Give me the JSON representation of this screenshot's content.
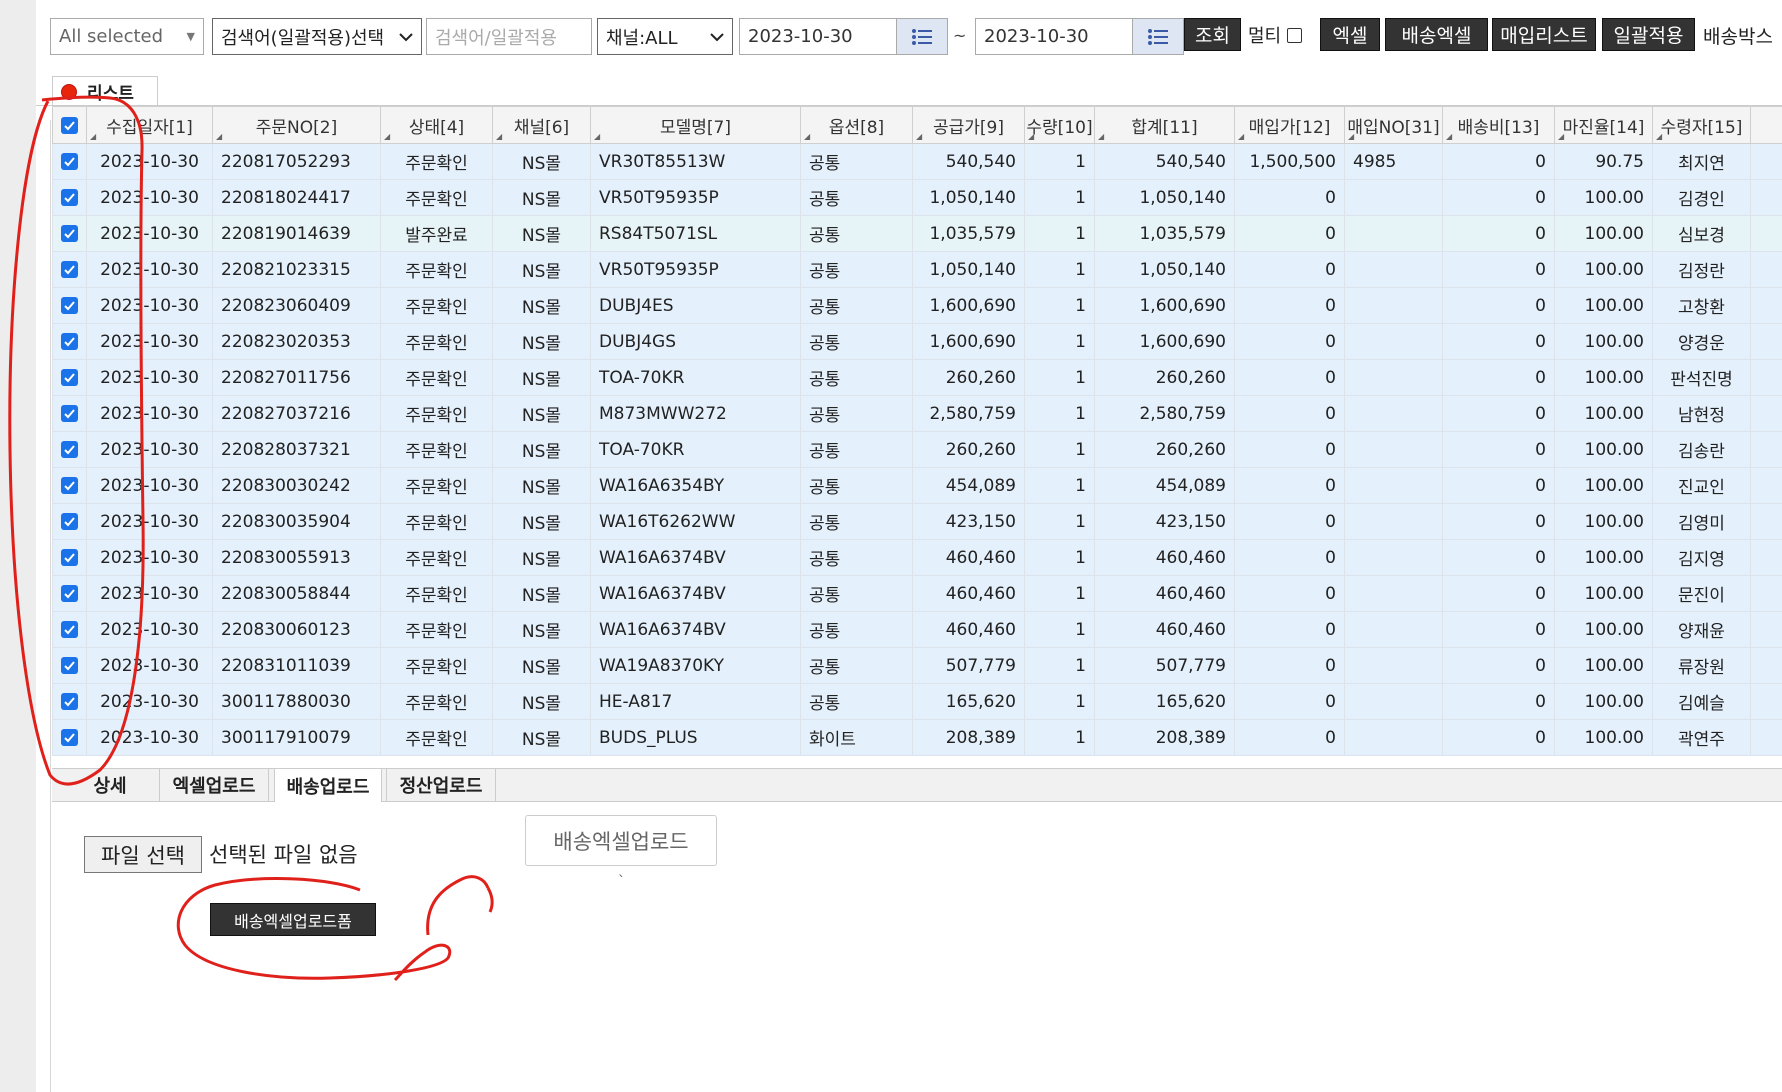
{
  "toolbar": {
    "multiselect_label": "All selected",
    "keyword_select_label": "검색어(일괄적용)선택",
    "keyword_input_placeholder": "검색어/일괄적용",
    "channel_select_label": "채널:ALL",
    "date_from": "2023-10-30",
    "date_sep": "~",
    "date_to": "2023-10-30",
    "search_label": "조회",
    "multi_label": "멀티",
    "excel_label": "엑셀",
    "delivery_excel_label": "배송엑셀",
    "purchase_list_label": "매입리스트",
    "bulk_apply_label": "일괄적용",
    "delivery_box_label": "배송박스"
  },
  "list_tab": {
    "label": "리스트"
  },
  "table": {
    "columns": [
      "수집일자[1]",
      "주문NO[2]",
      "상태[4]",
      "채널[6]",
      "모델명[7]",
      "옵션[8]",
      "공급가[9]",
      "수량[10]",
      "합계[11]",
      "매입가[12]",
      "매입NO[31]",
      "배송비[13]",
      "마진율[14]",
      "수령자[15]"
    ],
    "rows": [
      [
        "2023-10-30",
        "220817052293",
        "주문확인",
        "NS몰",
        "VR30T85513W",
        "공통",
        "540,540",
        "1",
        "540,540",
        "1,500,500",
        "4985",
        "0",
        "90.75",
        "최지연"
      ],
      [
        "2023-10-30",
        "220818024417",
        "주문확인",
        "NS몰",
        "VR50T95935P",
        "공통",
        "1,050,140",
        "1",
        "1,050,140",
        "0",
        "",
        "0",
        "100.00",
        "김경인"
      ],
      [
        "2023-10-30",
        "220819014639",
        "발주완료",
        "NS몰",
        "RS84T5071SL",
        "공통",
        "1,035,579",
        "1",
        "1,035,579",
        "0",
        "",
        "0",
        "100.00",
        "심보경"
      ],
      [
        "2023-10-30",
        "220821023315",
        "주문확인",
        "NS몰",
        "VR50T95935P",
        "공통",
        "1,050,140",
        "1",
        "1,050,140",
        "0",
        "",
        "0",
        "100.00",
        "김정란"
      ],
      [
        "2023-10-30",
        "220823060409",
        "주문확인",
        "NS몰",
        "DUBJ4ES",
        "공통",
        "1,600,690",
        "1",
        "1,600,690",
        "0",
        "",
        "0",
        "100.00",
        "고창환"
      ],
      [
        "2023-10-30",
        "220823020353",
        "주문확인",
        "NS몰",
        "DUBJ4GS",
        "공통",
        "1,600,690",
        "1",
        "1,600,690",
        "0",
        "",
        "0",
        "100.00",
        "양경운"
      ],
      [
        "2023-10-30",
        "220827011756",
        "주문확인",
        "NS몰",
        "TOA-70KR",
        "공통",
        "260,260",
        "1",
        "260,260",
        "0",
        "",
        "0",
        "100.00",
        "판석진명"
      ],
      [
        "2023-10-30",
        "220827037216",
        "주문확인",
        "NS몰",
        "M873MWW272",
        "공통",
        "2,580,759",
        "1",
        "2,580,759",
        "0",
        "",
        "0",
        "100.00",
        "남현정"
      ],
      [
        "2023-10-30",
        "220828037321",
        "주문확인",
        "NS몰",
        "TOA-70KR",
        "공통",
        "260,260",
        "1",
        "260,260",
        "0",
        "",
        "0",
        "100.00",
        "김송란"
      ],
      [
        "2023-10-30",
        "220830030242",
        "주문확인",
        "NS몰",
        "WA16A6354BY",
        "공통",
        "454,089",
        "1",
        "454,089",
        "0",
        "",
        "0",
        "100.00",
        "진교인"
      ],
      [
        "2023-10-30",
        "220830035904",
        "주문확인",
        "NS몰",
        "WA16T6262WW",
        "공통",
        "423,150",
        "1",
        "423,150",
        "0",
        "",
        "0",
        "100.00",
        "김영미"
      ],
      [
        "2023-10-30",
        "220830055913",
        "주문확인",
        "NS몰",
        "WA16A6374BV",
        "공통",
        "460,460",
        "1",
        "460,460",
        "0",
        "",
        "0",
        "100.00",
        "김지영"
      ],
      [
        "2023-10-30",
        "220830058844",
        "주문확인",
        "NS몰",
        "WA16A6374BV",
        "공통",
        "460,460",
        "1",
        "460,460",
        "0",
        "",
        "0",
        "100.00",
        "문진이"
      ],
      [
        "2023-10-30",
        "220830060123",
        "주문확인",
        "NS몰",
        "WA16A6374BV",
        "공통",
        "460,460",
        "1",
        "460,460",
        "0",
        "",
        "0",
        "100.00",
        "양재윤"
      ],
      [
        "2023-10-30",
        "220831011039",
        "주문확인",
        "NS몰",
        "WA19A8370KY",
        "공통",
        "507,779",
        "1",
        "507,779",
        "0",
        "",
        "0",
        "100.00",
        "류장원"
      ],
      [
        "2023-10-30",
        "300117880030",
        "주문확인",
        "NS몰",
        "HE-A817",
        "공통",
        "165,620",
        "1",
        "165,620",
        "0",
        "",
        "0",
        "100.00",
        "김예슬"
      ],
      [
        "2023-10-30",
        "300117910079",
        "주문확인",
        "NS몰",
        "BUDS_PLUS",
        "화이트",
        "208,389",
        "1",
        "208,389",
        "0",
        "",
        "0",
        "100.00",
        "곽연주"
      ]
    ]
  },
  "bottom_tabs": [
    "상세",
    "엑셀업로드",
    "배송업로드",
    "정산업로드"
  ],
  "upload": {
    "file_button_label": "파일 선택",
    "no_file_label": "선택된 파일 없음",
    "upload_box_label": "배송엑셀업로드",
    "tick_mark": "`",
    "form_button_label": "배송엑셀업로드폼"
  },
  "colors": {
    "annotation": "#e0201a",
    "accent": "#1a73e8",
    "row_bg": "#e4f0fb",
    "dark_button": "#333333"
  }
}
